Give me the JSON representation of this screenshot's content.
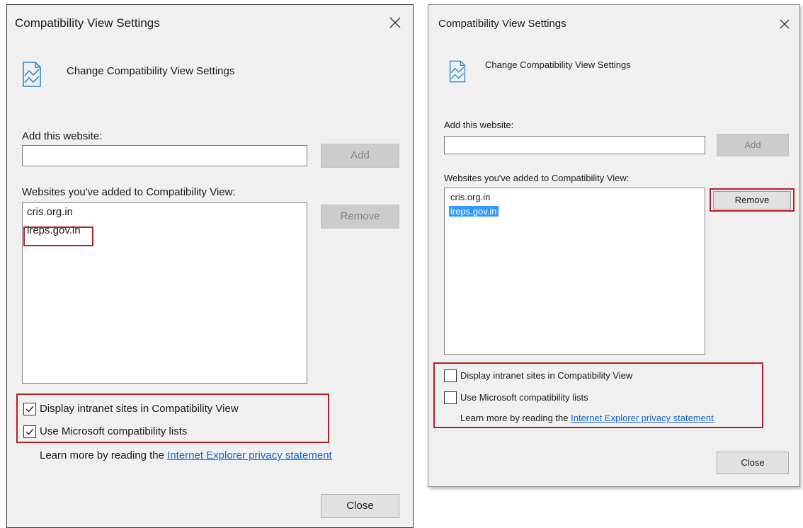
{
  "left_dialog": {
    "title": "Compatibility View Settings",
    "heading": "Change Compatibility View Settings",
    "add_label": "Add this website:",
    "add_input_value": "",
    "add_button": "Add",
    "list_label": "Websites you've added to Compatibility View:",
    "sites": [
      "cris.org.in",
      "ireps.gov.in"
    ],
    "selected_site": null,
    "remove_button": "Remove",
    "remove_enabled": false,
    "checkbox_intranet": {
      "label": "Display intranet sites in Compatibility View",
      "checked": true
    },
    "checkbox_ms_lists": {
      "label": "Use Microsoft compatibility lists",
      "checked": true
    },
    "learn_more_text": "Learn more by reading the",
    "learn_more_link": "Internet Explorer privacy statement",
    "close_button": "Close"
  },
  "right_dialog": {
    "title": "Compatibility View Settings",
    "heading": "Change Compatibility View Settings",
    "add_label": "Add this website:",
    "add_input_value": "",
    "add_button": "Add",
    "list_label": "Websites you've added to Compatibility View:",
    "sites": [
      "cris.org.in",
      "ireps.gov.in"
    ],
    "selected_site": "ireps.gov.in",
    "remove_button": "Remove",
    "remove_enabled": true,
    "checkbox_intranet": {
      "label": "Display intranet sites in Compatibility View",
      "checked": false
    },
    "checkbox_ms_lists": {
      "label": "Use Microsoft compatibility lists",
      "checked": false
    },
    "learn_more_text": "Learn more by reading the",
    "learn_more_link": "Internet Explorer privacy statement",
    "close_button": "Close"
  },
  "icons": {
    "close": "close-icon",
    "settings": "compatibility-view-icon",
    "check": "checkmark-icon"
  },
  "colors": {
    "highlight_box": "#b51e25",
    "selection": "#3399ff",
    "link": "#1b64c9",
    "dialog_bg": "#f0f0f0"
  }
}
